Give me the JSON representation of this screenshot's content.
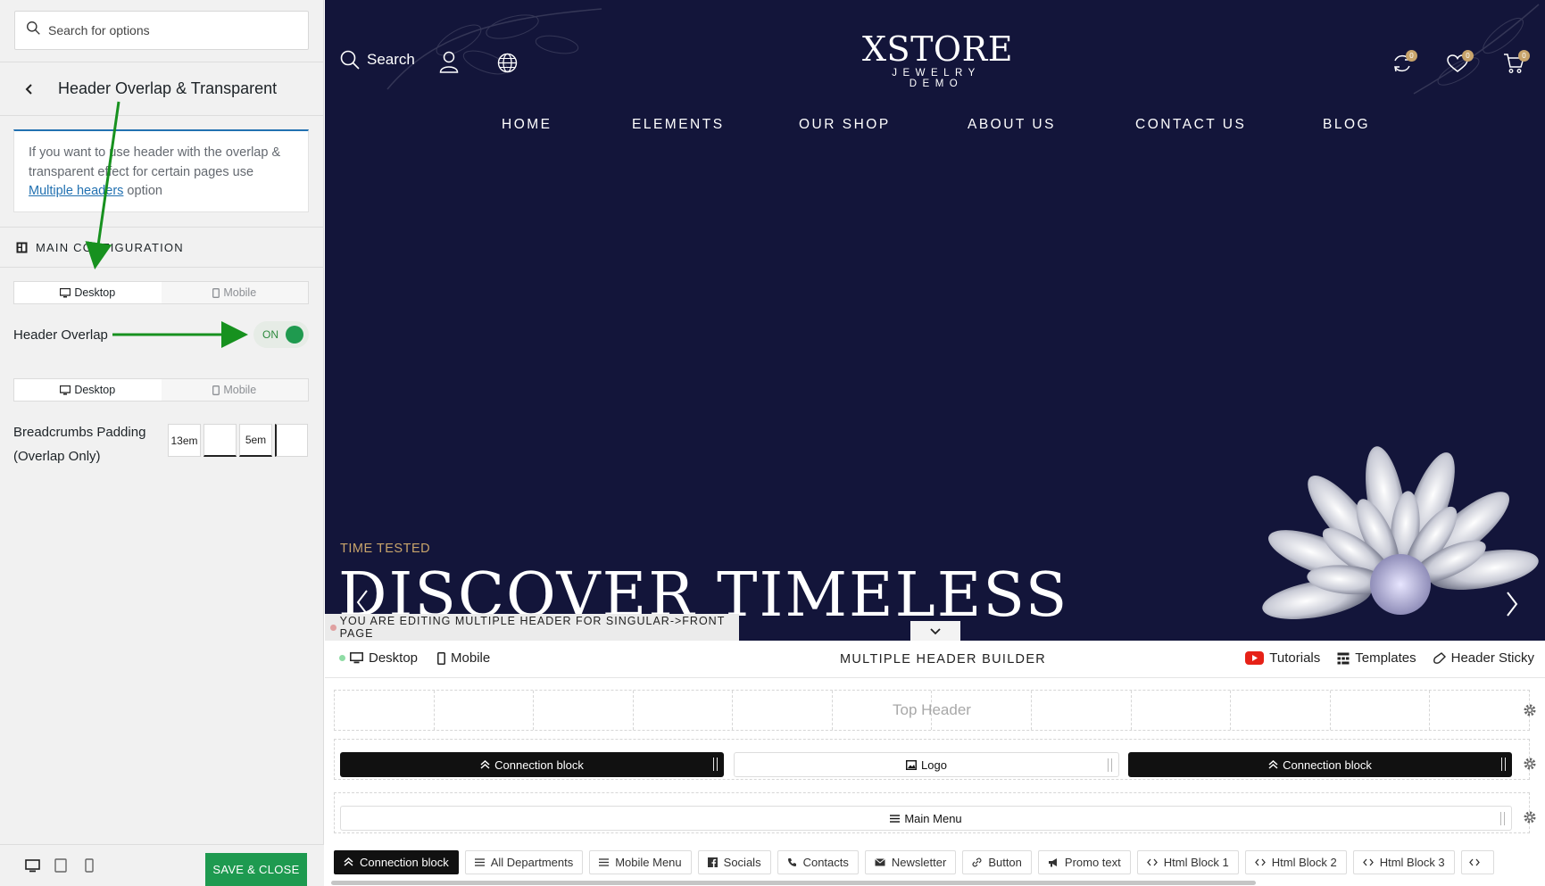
{
  "panel": {
    "search_placeholder": "Search for options",
    "section_title": "Header Overlap & Transparent",
    "notice": {
      "text_before": "If you want to use header with the overlap & transparent effect for certain pages use ",
      "link": "Multiple headers",
      "text_after": " option"
    },
    "config_title": "MAIN CONFIGURATION",
    "device_tabs": [
      "Desktop",
      "Mobile"
    ],
    "overlap_label": "Header Overlap",
    "overlap_state": "ON",
    "padding_label_1": "Breadcrumbs Padding",
    "padding_label_2": "(Overlap Only)",
    "padding_values": [
      "13em",
      "",
      "5em",
      ""
    ],
    "save_label": "SAVE & CLOSE"
  },
  "preview": {
    "search_label": "Search",
    "logo_main": "XSTORE",
    "logo_sub": "JEWELRY DEMO",
    "badges": [
      "0",
      "0",
      "0"
    ],
    "nav": [
      "HOME",
      "ELEMENTS",
      "OUR SHOP",
      "ABOUT US",
      "CONTACT US",
      "BLOG"
    ],
    "eyebrow": "TIME TESTED",
    "hero_title": "DISCOVER TIMELESS",
    "editing_notice": "YOU ARE EDITING MULTIPLE HEADER FOR SINGULAR->FRONT PAGE"
  },
  "builder": {
    "device_desktop": "Desktop",
    "device_mobile": "Mobile",
    "title": "MULTIPLE HEADER BUILDER",
    "tutorials": "Tutorials",
    "templates": "Templates",
    "sticky": "Header Sticky",
    "top_header": "Top Header",
    "block_connection_left": "Connection block",
    "block_logo": "Logo",
    "block_connection_right": "Connection block",
    "block_main_menu": "Main Menu",
    "elements": [
      "Connection block",
      "All Departments",
      "Mobile Menu",
      "Socials",
      "Contacts",
      "Newsletter",
      "Button",
      "Promo text",
      "Html Block 1",
      "Html Block 2",
      "Html Block 3"
    ]
  },
  "colors": {
    "accent_green": "#1e9a50",
    "preview_bg": "#13153a",
    "gold": "#c8a46b",
    "link_blue": "#2271b1"
  }
}
